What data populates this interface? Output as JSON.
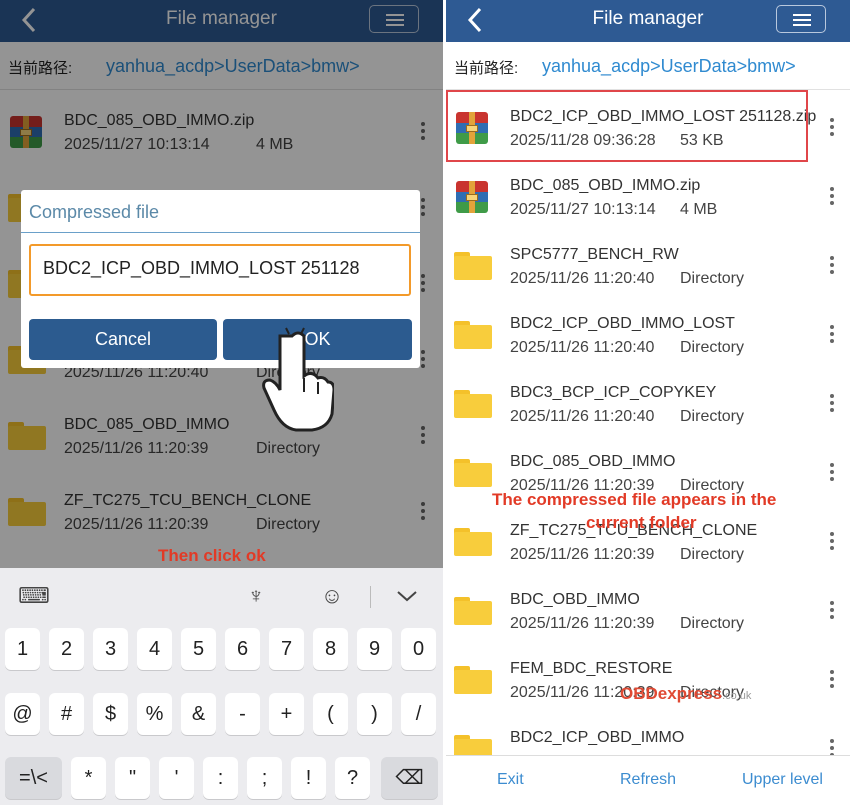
{
  "left": {
    "title": "File manager",
    "path_label": "当前路径:",
    "path": "yanhua_acdp>UserData>bmw>",
    "files": [
      {
        "name": "BDC_085_OBD_IMMO.zip",
        "date": "2025/11/27 10:13:14",
        "meta": "4 MB",
        "type": "zip"
      },
      {
        "name": "",
        "date": "",
        "meta": "",
        "type": "folder"
      },
      {
        "name": "",
        "date": "",
        "meta": "",
        "type": "folder"
      },
      {
        "name": "",
        "date": "2025/11/26 11:20:40",
        "meta": "Directory",
        "type": "folder"
      },
      {
        "name": "BDC_085_OBD_IMMO",
        "date": "2025/11/26 11:20:39",
        "meta": "Directory",
        "type": "folder"
      },
      {
        "name": "ZF_TC275_TCU_BENCH_CLONE",
        "date": "2025/11/26 11:20:39",
        "meta": "Directory",
        "type": "folder"
      }
    ],
    "dialog": {
      "title": "Compressed file",
      "input_value": "BDC2_ICP_OBD_IMMO_LOST 251128",
      "cancel_label": "Cancel",
      "ok_label": "OK"
    },
    "annotation": "Then click ok",
    "keyboard": {
      "toolbar_icons": [
        "globe-keyboard-icon",
        "paint-brush-icon",
        "emoji-icon",
        "chevron-down-icon"
      ],
      "row1": [
        "1",
        "2",
        "3",
        "4",
        "5",
        "6",
        "7",
        "8",
        "9",
        "0"
      ],
      "row2": [
        "@",
        "#",
        "$",
        "%",
        "&",
        "-",
        "+",
        "(",
        ")",
        "/"
      ],
      "row3": [
        "=\\<",
        "*",
        "\"",
        "'",
        ":",
        ";",
        "!",
        "?",
        "⌫"
      ]
    }
  },
  "right": {
    "title": "File manager",
    "path_label": "当前路径:",
    "path": "yanhua_acdp>UserData>bmw>",
    "files": [
      {
        "name": "BDC2_ICP_OBD_IMMO_LOST 251128.zip",
        "date": "2025/11/28 09:36:28",
        "meta": "53 KB",
        "type": "zip"
      },
      {
        "name": "BDC_085_OBD_IMMO.zip",
        "date": "2025/11/27 10:13:14",
        "meta": "4 MB",
        "type": "zip"
      },
      {
        "name": "SPC5777_BENCH_RW",
        "date": "2025/11/26 11:20:40",
        "meta": "Directory",
        "type": "folder"
      },
      {
        "name": "BDC2_ICP_OBD_IMMO_LOST",
        "date": "2025/11/26 11:20:40",
        "meta": "Directory",
        "type": "folder"
      },
      {
        "name": "BDC3_BCP_ICP_COPYKEY",
        "date": "2025/11/26 11:20:40",
        "meta": "Directory",
        "type": "folder"
      },
      {
        "name": "BDC_085_OBD_IMMO",
        "date": "2025/11/26 11:20:39",
        "meta": "Directory",
        "type": "folder"
      },
      {
        "name": "ZF_TC275_TCU_BENCH_CLONE",
        "date": "2025/11/26 11:20:39",
        "meta": "Directory",
        "type": "folder"
      },
      {
        "name": "BDC_OBD_IMMO",
        "date": "2025/11/26 11:20:39",
        "meta": "Directory",
        "type": "folder"
      },
      {
        "name": "FEM_BDC_RESTORE",
        "date": "2025/11/26 11:20:39",
        "meta": "Directory",
        "type": "folder"
      },
      {
        "name": "BDC2_ICP_OBD_IMMO",
        "date": "",
        "meta": "",
        "type": "folder"
      }
    ],
    "annotation_line1": "The compressed file appears in the",
    "annotation_line2": "current folder",
    "bottom": {
      "exit": "Exit",
      "refresh": "Refresh",
      "upper": "Upper level"
    },
    "watermark": {
      "brand": "OBDexpress",
      "tld": ".co.uk"
    }
  },
  "colors": {
    "titlebar": "#2e5a93",
    "path": "#2f8ad0",
    "annotation": "#e23a26",
    "highlight": "#e0464a",
    "dialog_button": "#2c5b8f",
    "input_border": "#f39a2a"
  }
}
